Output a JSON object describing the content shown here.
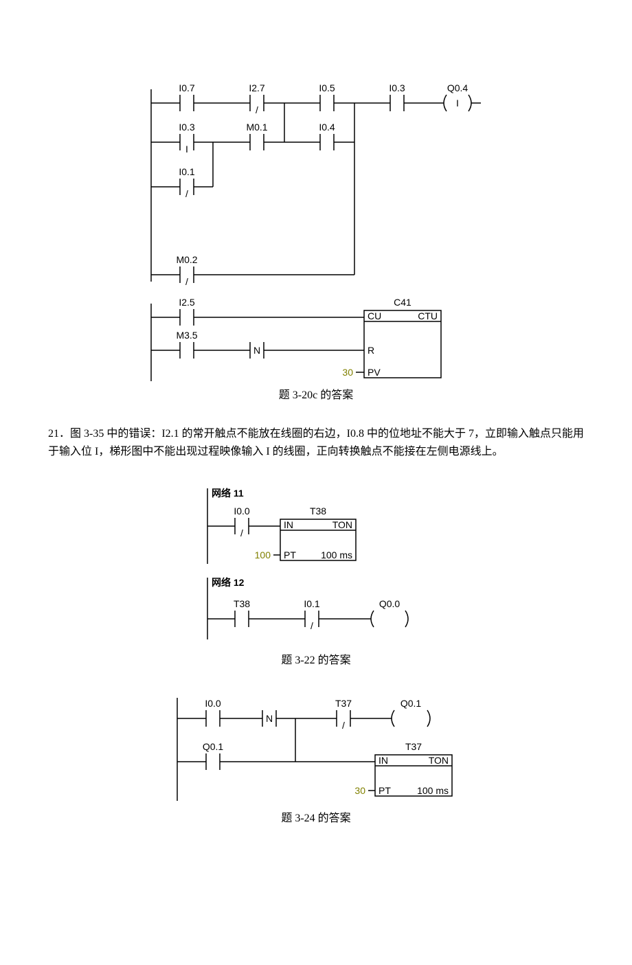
{
  "diagram1": {
    "rung1": {
      "c1": {
        "addr": "I0.7",
        "mod": ""
      },
      "c2": {
        "addr": "I2.7",
        "mod": "/"
      },
      "c3": {
        "addr": "I0.5",
        "mod": ""
      },
      "c4": {
        "addr": "I0.3",
        "mod": ""
      },
      "coil": {
        "addr": "Q0.4",
        "mod": "I"
      }
    },
    "rung2": {
      "c1": {
        "addr": "I0.3",
        "mod": "I"
      },
      "c2": {
        "addr": "M0.1",
        "mod": ""
      },
      "c3": {
        "addr": "I0.4",
        "mod": ""
      }
    },
    "rung3": {
      "c1": {
        "addr": "I0.1",
        "mod": "/"
      }
    },
    "rung4": {
      "c1": {
        "addr": "M0.2",
        "mod": "/"
      }
    },
    "net2": {
      "r1": {
        "c1": {
          "addr": "I2.5",
          "mod": ""
        }
      },
      "r2": {
        "c1": {
          "addr": "M3.5",
          "mod": ""
        },
        "c2": {
          "addr": "",
          "mod": "N"
        }
      },
      "counter": {
        "name": "C41",
        "type": "CTU",
        "in1": "CU",
        "in2": "R",
        "in3": "PV",
        "pv": "30"
      }
    },
    "caption": "题 3-20c 的答案"
  },
  "paragraph": "21．图 3-35 中的错误：I2.1 的常开触点不能放在线圈的右边，I0.8 中的位地址不能大于 7，立即输入触点只能用于输入位 I，梯形图中不能出现过程映像输入 I 的线圈，正向转换触点不能接在左侧电源线上。",
  "diagram2": {
    "net11": {
      "title": "网络 11",
      "c1": {
        "addr": "I0.0",
        "mod": "/"
      },
      "timer": {
        "name": "T38",
        "type": "TON",
        "in1": "IN",
        "in2": "PT",
        "pt": "100",
        "base": "100 ms"
      }
    },
    "net12": {
      "title": "网络 12",
      "c1": {
        "addr": "T38",
        "mod": ""
      },
      "c2": {
        "addr": "I0.1",
        "mod": "/"
      },
      "coil": {
        "addr": "Q0.0",
        "mod": ""
      }
    },
    "caption": "题 3-22 的答案"
  },
  "diagram3": {
    "r1": {
      "c1": {
        "addr": "I0.0",
        "mod": ""
      },
      "c2": {
        "addr": "",
        "mod": "N"
      },
      "c3": {
        "addr": "T37",
        "mod": "/"
      },
      "coil": {
        "addr": "Q0.1",
        "mod": ""
      }
    },
    "r2": {
      "c1": {
        "addr": "Q0.1",
        "mod": ""
      }
    },
    "timer": {
      "name": "T37",
      "type": "TON",
      "in1": "IN",
      "in2": "PT",
      "pt": "30",
      "base": "100 ms"
    },
    "caption": "题 3-24 的答案"
  }
}
